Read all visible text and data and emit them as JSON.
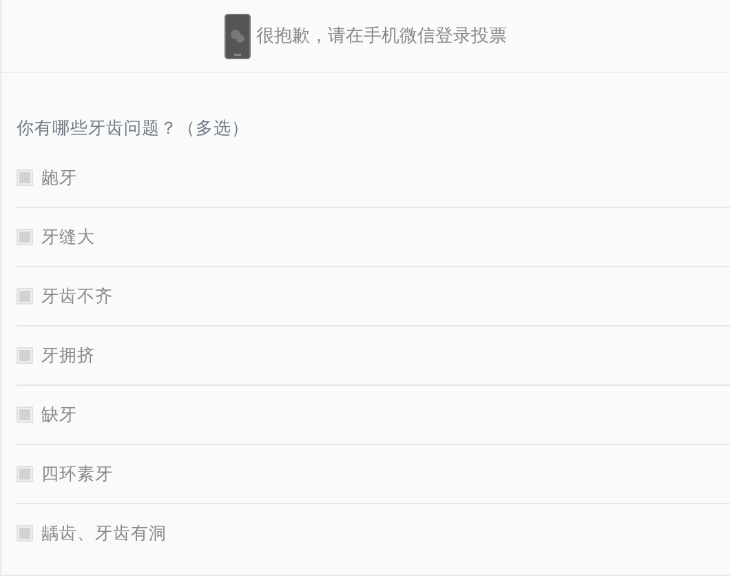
{
  "notice": {
    "text": "很抱歉，请在手机微信登录投票"
  },
  "question": {
    "title": "你有哪些牙齿问题？（多选）",
    "options": [
      {
        "label": "龅牙",
        "checked": false
      },
      {
        "label": "牙缝大",
        "checked": false
      },
      {
        "label": "牙齿不齐",
        "checked": false
      },
      {
        "label": "牙拥挤",
        "checked": false
      },
      {
        "label": "缺牙",
        "checked": false
      },
      {
        "label": "四环素牙",
        "checked": false
      },
      {
        "label": "龋齿、牙齿有洞",
        "checked": false
      }
    ]
  }
}
